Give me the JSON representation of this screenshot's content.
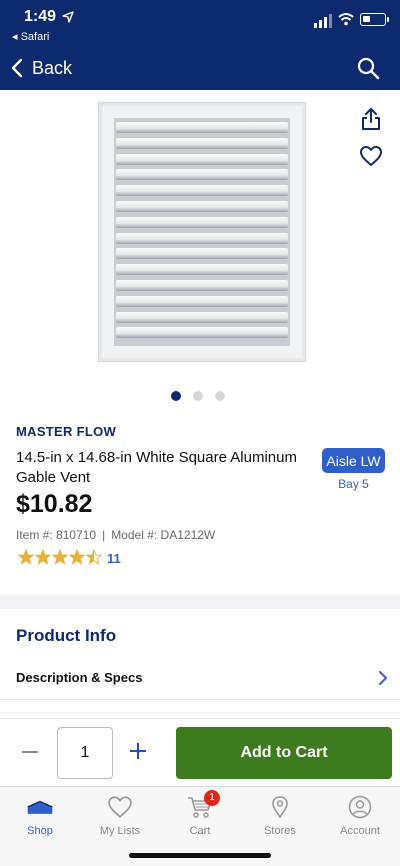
{
  "status_bar": {
    "time": "1:49",
    "back_app": "◂ Safari"
  },
  "nav": {
    "back_label": "Back"
  },
  "product": {
    "brand": "MASTER FLOW",
    "title": "14.5-in x 14.68-in White Square Aluminum Gable Vent",
    "price": "$10.82",
    "item_number": "Item #: 810710",
    "separator": "|",
    "model_number": "Model #: DA1212W",
    "rating": 4.5,
    "review_count": "11",
    "aisle": "Aisle LW",
    "bay": "Bay 5",
    "image_count": 3,
    "image_index": 1
  },
  "section": {
    "title": "Product Info",
    "description_row": "Description & Specs"
  },
  "cart_bar": {
    "quantity": "1",
    "add_label": "Add to Cart"
  },
  "tabbar": {
    "tabs": [
      {
        "label": "Shop",
        "icon": "shop-icon",
        "active": true
      },
      {
        "label": "My Lists",
        "icon": "heart-icon"
      },
      {
        "label": "Cart",
        "icon": "cart-icon",
        "badge": "1"
      },
      {
        "label": "Stores",
        "icon": "location-pin-icon"
      },
      {
        "label": "Account",
        "icon": "user-icon"
      }
    ]
  },
  "colors": {
    "navy": "#0d2a6f",
    "accent_blue": "#2f5fc9",
    "cart_green": "#3e7a1e",
    "star": "#e8b23a",
    "badge_red": "#e0251b"
  }
}
